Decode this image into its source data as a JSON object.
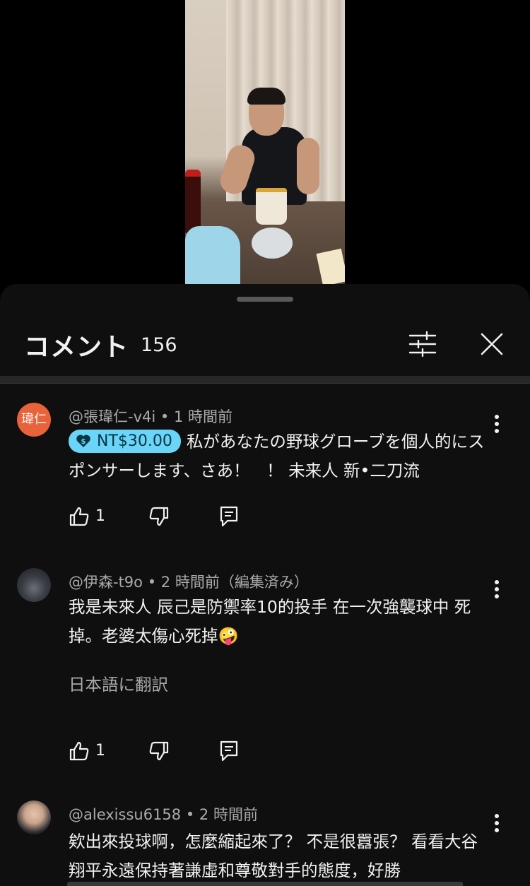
{
  "header": {
    "title": "コメント",
    "count": "156"
  },
  "comments": [
    {
      "avatar_text": "瑋仁",
      "author": "@張瑋仁-v4i",
      "time": "1 時間前",
      "donation": "NT$30.00",
      "text": "私があなたの野球グローブを個人的にスポンサーします、さあ！　！ 未来人 新•二刀流",
      "likes": "1"
    },
    {
      "author": "@伊森-t9o",
      "time": "2 時間前（編集済み）",
      "text": "我是未來人 辰己是防禦率10的投手 在一次強襲球中 死掉。老婆太傷心死掉🤪",
      "translate": "日本語に翻訳",
      "likes": "1"
    },
    {
      "author": "@alexissu6158",
      "time": "2 時間前",
      "text": "欸出來投球啊，怎麼縮起來了？ 不是很囂張？ 看看大谷翔平永遠保持著謙虛和尊敬對手的態度，好勝"
    }
  ],
  "separator": " • ",
  "icons": {
    "filter": "tune-sliders-icon",
    "close": "close-icon",
    "more": "more-vert-icon",
    "like": "thumb-up-icon",
    "dislike": "thumb-down-icon",
    "reply": "reply-comment-icon",
    "donation": "heart-dollar-icon"
  },
  "colors": {
    "sheet_background": "#0f0f0f",
    "donation_chip": "#6ad5f7",
    "avatar_1": "#e8623a",
    "secondary_text": "#aaaaaa"
  }
}
